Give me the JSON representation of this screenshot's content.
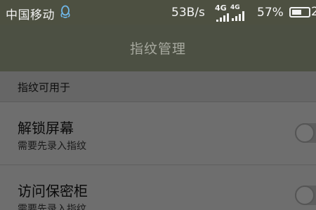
{
  "status_bar": {
    "carrier": "中国移动",
    "net_speed": "53B/s",
    "network_1": "4G",
    "network_2": "4G",
    "battery_percent": "57%",
    "battery_level": 0.57,
    "clock": "2"
  },
  "header": {
    "title": "指纹管理"
  },
  "section": {
    "title": "指纹可用于"
  },
  "items": [
    {
      "title": "解锁屏幕",
      "subtitle": "需要先录入指纹",
      "enabled": false
    },
    {
      "title": "访问保密柜",
      "subtitle": "需要先录入指纹",
      "enabled": false
    }
  ],
  "colors": {
    "overlay_bg": "#6e6e6e",
    "title_bar": "#4c5043",
    "status_text": "#f2f2f2"
  }
}
